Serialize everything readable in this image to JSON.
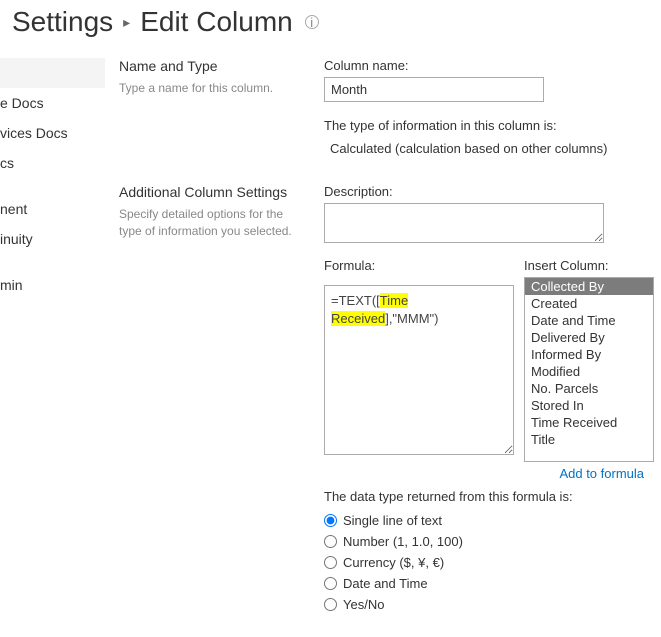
{
  "header": {
    "crumb_a": "Settings",
    "crumb_b": "Edit Column"
  },
  "leftnav": {
    "items": [
      {
        "label": ""
      },
      {
        "label": "e Docs"
      },
      {
        "label": "vices Docs"
      },
      {
        "label": "cs"
      },
      {
        "label": ""
      },
      {
        "label": "nent"
      },
      {
        "label": "inuity"
      },
      {
        "label": ""
      },
      {
        "label": "min"
      }
    ]
  },
  "section1": {
    "title": "Name and Type",
    "desc": "Type a name for this column.",
    "column_name_label": "Column name:",
    "column_name_value": "Month",
    "type_info_label": "The type of information in this column is:",
    "type_info_value": "Calculated (calculation based on other columns)"
  },
  "section2": {
    "title": "Additional Column Settings",
    "desc": "Specify detailed options for the type of information you selected.",
    "description_label": "Description:",
    "description_value": "",
    "formula_label": "Formula:",
    "formula_prefix": "=TEXT([",
    "formula_highlight": "Time Received",
    "formula_suffix": "],\"MMM\")",
    "insert_label": "Insert Column:",
    "insert_options": [
      "Collected By",
      "Created",
      "Date and Time",
      "Delivered By",
      "Informed By",
      "Modified",
      "No. Parcels",
      "Stored In",
      "Time Received",
      "Title"
    ],
    "insert_selected_index": 0,
    "add_link": "Add to formula",
    "datatype_label": "The data type returned from this formula is:",
    "datatype_options": [
      "Single line of text",
      "Number (1, 1.0, 100)",
      "Currency ($, ¥, €)",
      "Date and Time",
      "Yes/No"
    ],
    "datatype_selected_index": 0
  }
}
